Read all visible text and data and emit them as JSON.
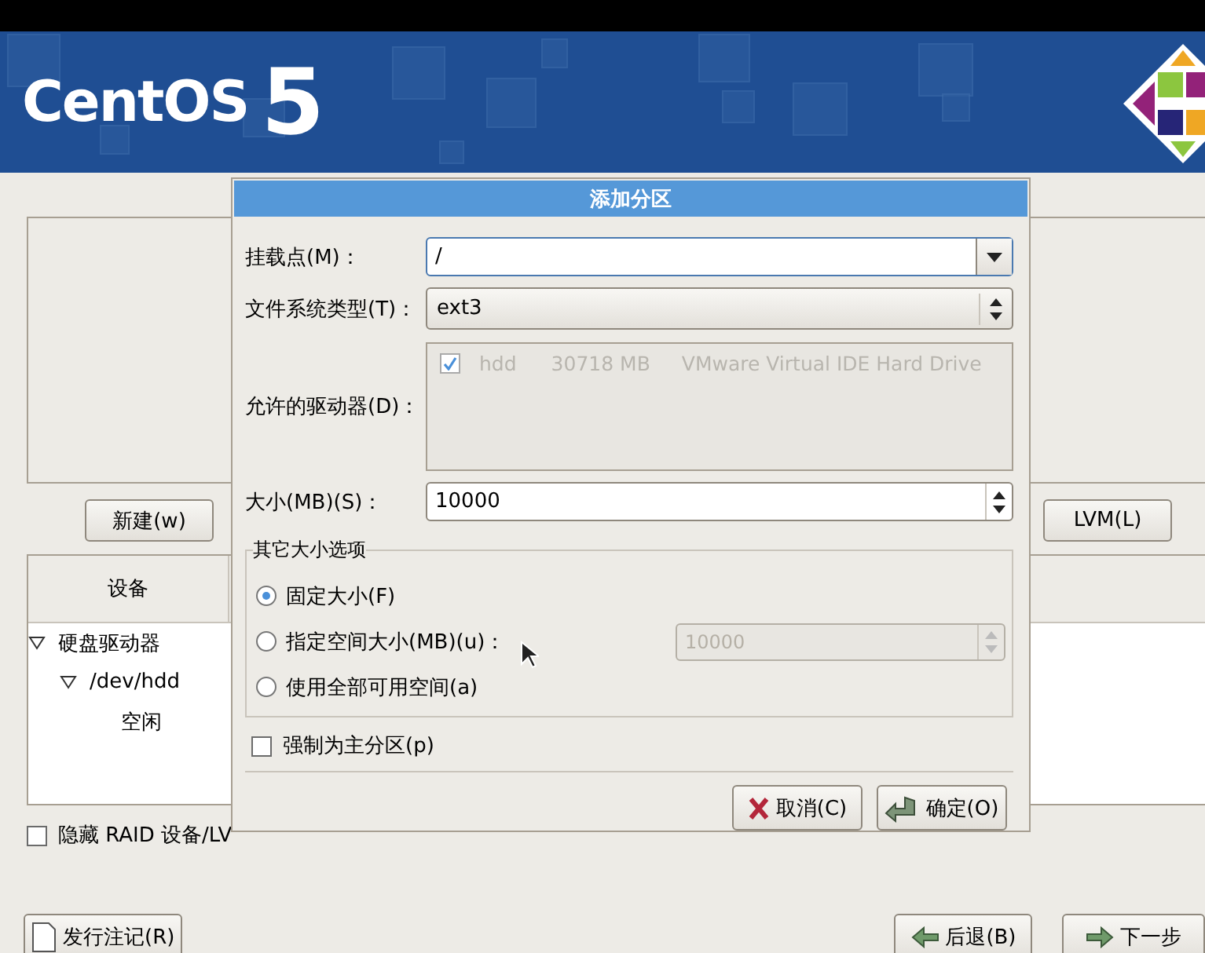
{
  "banner": {
    "logo_text": "CentOS",
    "logo_version": "5"
  },
  "toolbar_buttons": [
    {
      "label": "新建(w)"
    },
    {
      "label": "LVM(L)"
    }
  ],
  "device_table": {
    "columns": [
      "设备"
    ],
    "tree": [
      {
        "label": "硬盘驱动器",
        "expanded": true,
        "children": [
          {
            "label": "/dev/hdd",
            "expanded": true,
            "children": [
              {
                "label": "空闲"
              }
            ]
          }
        ]
      }
    ]
  },
  "hide_raid": {
    "label": "隐藏 RAID 设备/LV",
    "checked": false
  },
  "nav_buttons": [
    {
      "label": "发行注记(R)",
      "kind": "notes"
    },
    {
      "label": "后退(B)",
      "kind": "back"
    },
    {
      "label": "下一步",
      "kind": "next"
    }
  ],
  "dialog": {
    "title": "添加分区",
    "mount_point": {
      "label": "挂载点(M)：",
      "value": "/"
    },
    "fs_type": {
      "label": "文件系统类型(T)：",
      "value": "ext3"
    },
    "drives": {
      "label": "允许的驱动器(D)：",
      "items": [
        {
          "checked": true,
          "name": "hdd",
          "size": "30718 MB",
          "model": "VMware Virtual IDE Hard Drive"
        }
      ]
    },
    "size": {
      "label": "大小(MB)(S)：",
      "value": "10000"
    },
    "size_options": {
      "title": "其它大小选项",
      "options": [
        {
          "label": "固定大小(F)",
          "selected": true
        },
        {
          "label": "指定空间大小(MB)(u)：",
          "selected": false,
          "spin_value": "10000",
          "disabled": true
        },
        {
          "label": "使用全部可用空间(a)",
          "selected": false
        }
      ]
    },
    "force_primary": {
      "label": "强制为主分区(p)",
      "checked": false
    },
    "buttons": [
      {
        "label": "取消(C)",
        "kind": "cancel"
      },
      {
        "label": "确定(O)",
        "kind": "ok"
      }
    ]
  }
}
